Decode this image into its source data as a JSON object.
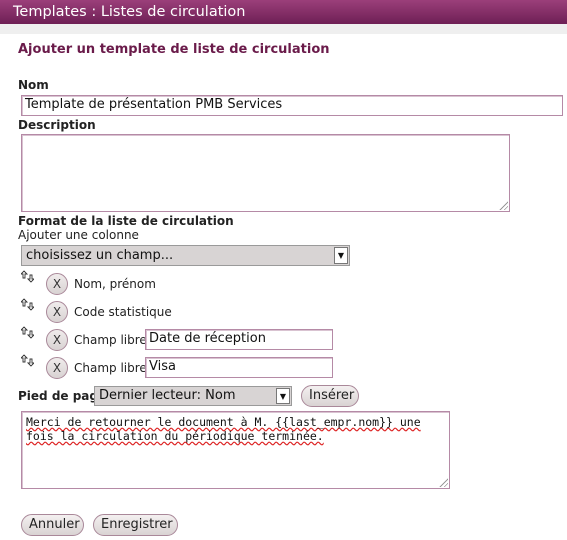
{
  "window": {
    "title": "Templates : Listes de circulation"
  },
  "form": {
    "heading": "Ajouter un template de liste de circulation",
    "name": {
      "label": "Nom",
      "value": "Template de présentation PMB Services"
    },
    "description": {
      "label": "Description",
      "value": ""
    },
    "format": {
      "label": "Format de la liste de circulation",
      "add_column_label": "Ajouter une colonne",
      "field_select": "choisissez un champ...",
      "columns": [
        {
          "label": "Nom, prénom",
          "value": null
        },
        {
          "label": "Code statistique",
          "value": null
        },
        {
          "label": "Champ libre",
          "value": "Date de réception"
        },
        {
          "label": "Champ libre",
          "value": "Visa"
        }
      ],
      "delete_glyph": "X"
    },
    "footer": {
      "label": "Pied de page",
      "select": "Dernier lecteur: Nom",
      "insert_button": "Insérer",
      "text_line1": "Merci de retourner le document à M. {{last_empr.nom}} une",
      "text_line2": "fois la circulation du périodique terminée."
    },
    "buttons": {
      "cancel": "Annuler",
      "save": "Enregistrer"
    }
  }
}
